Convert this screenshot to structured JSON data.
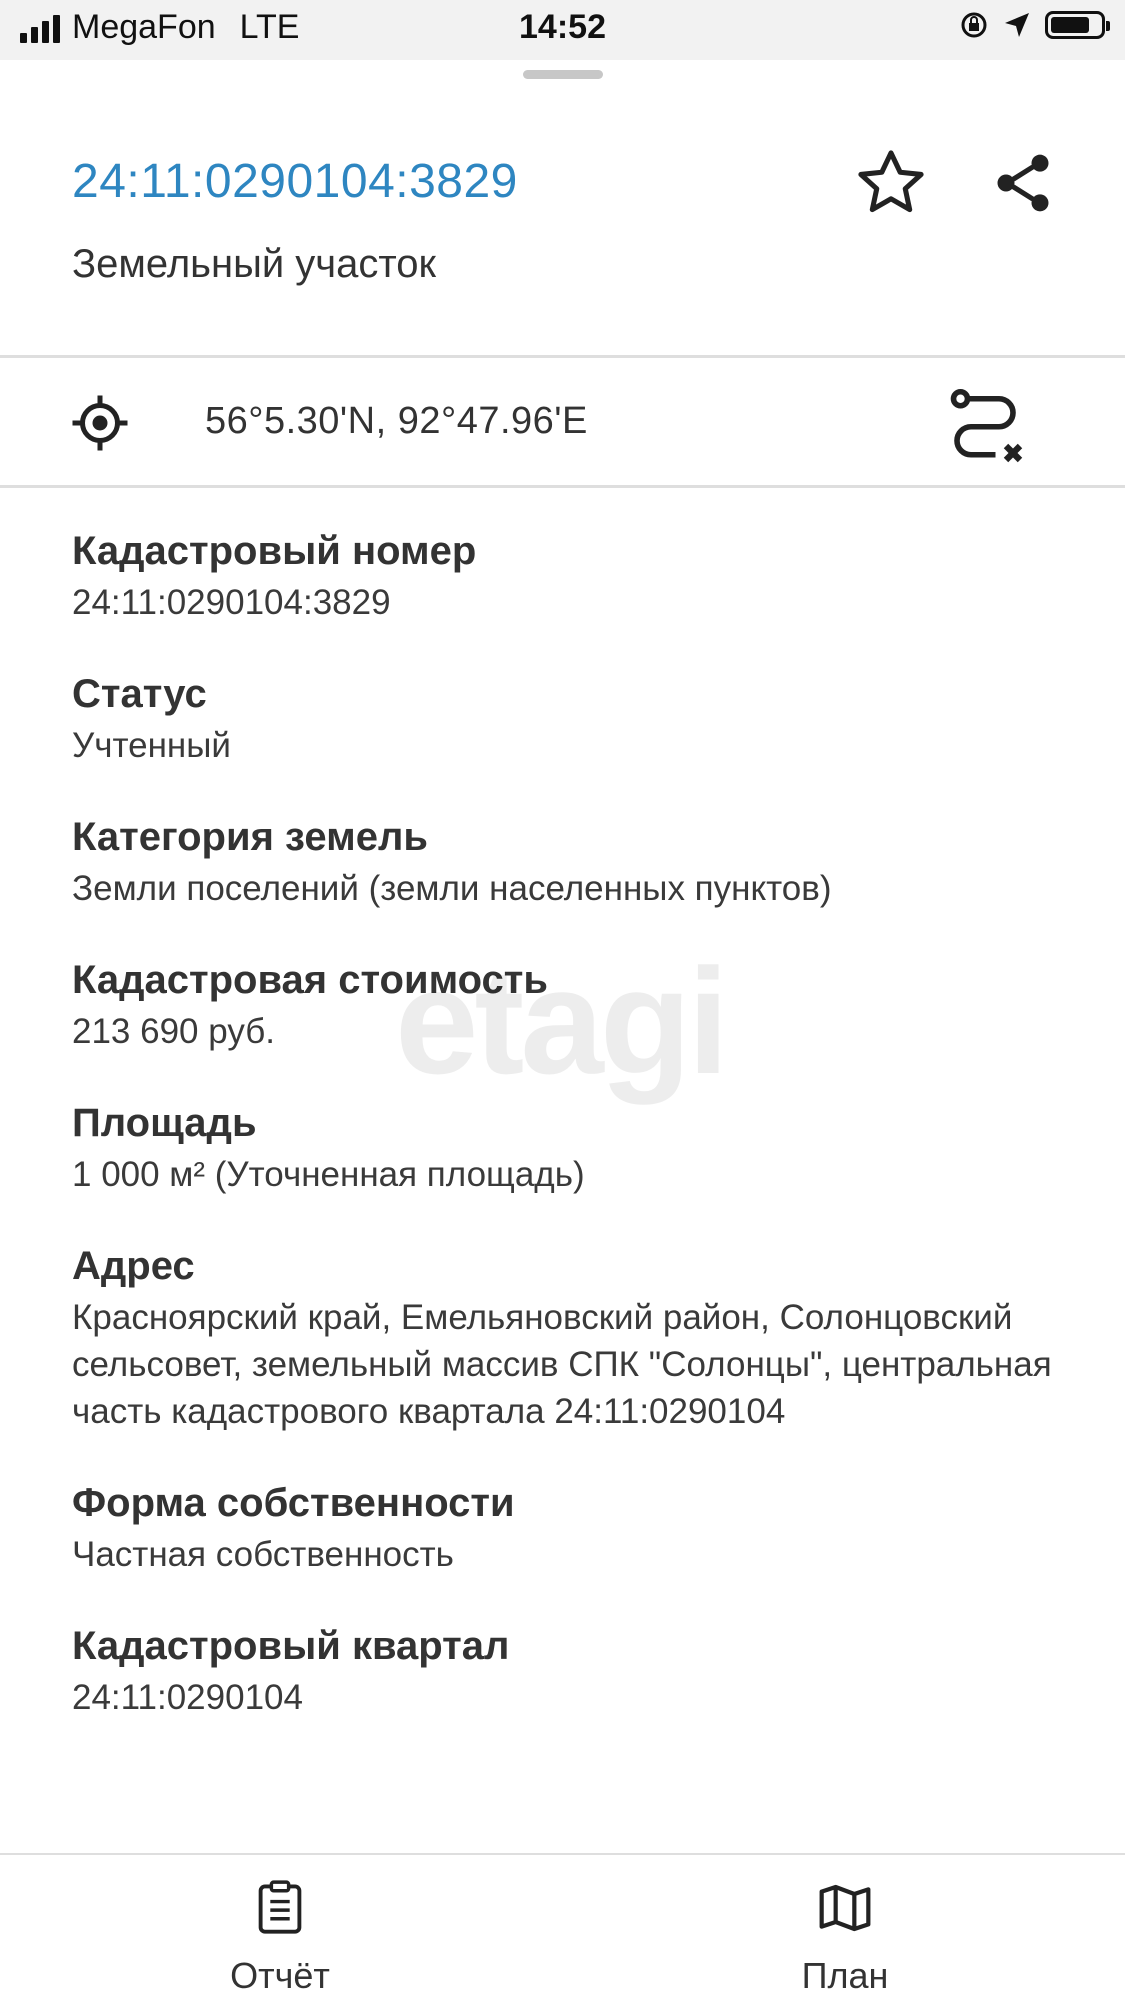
{
  "status_bar": {
    "carrier": "MegaFon",
    "network": "LTE",
    "time": "14:52"
  },
  "header": {
    "title": "24:11:0290104:3829",
    "subtitle": "Земельный участок"
  },
  "location": {
    "coordinates": "56°5.30'N, 92°47.96'E"
  },
  "details": [
    {
      "label": "Кадастровый номер",
      "value": "24:11:0290104:3829"
    },
    {
      "label": "Статус",
      "value": "Учтенный"
    },
    {
      "label": "Категория земель",
      "value": "Земли поселений (земли населенных пунктов)"
    },
    {
      "label": "Кадастровая стоимость",
      "value": "213 690 руб."
    },
    {
      "label": "Площадь",
      "value": "1 000 м² (Уточненная площадь)"
    },
    {
      "label": "Адрес",
      "value": "Красноярский край, Емельяновский район, Солонцовский сельсовет, земельный массив СПК \"Солонцы\", центральная часть кадастрового квартала 24:11:0290104"
    },
    {
      "label": "Форма собственности",
      "value": "Частная собственность"
    },
    {
      "label": "Кадастровый квартал",
      "value": "24:11:0290104"
    }
  ],
  "watermark": "etagi",
  "bottom_tabs": {
    "report": "Отчёт",
    "plan": "План"
  },
  "colors": {
    "accent": "#2e86c1",
    "divider": "#dedede"
  }
}
